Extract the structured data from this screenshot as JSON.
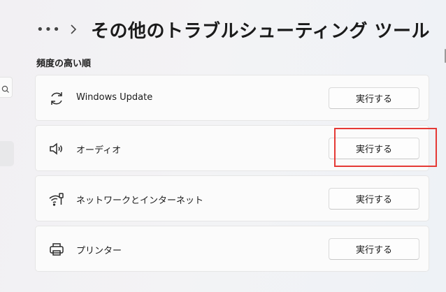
{
  "header": {
    "more_label": "•••",
    "title": "その他のトラブルシューティング ツール"
  },
  "section": {
    "title": "頻度の高い順"
  },
  "troubleshooters": [
    {
      "label": "Windows Update",
      "button": "実行する",
      "icon": "refresh-icon"
    },
    {
      "label": "オーディオ",
      "button": "実行する",
      "icon": "speaker-icon"
    },
    {
      "label": "ネットワークとインターネット",
      "button": "実行する",
      "icon": "wifi-ethernet-icon"
    },
    {
      "label": "プリンター",
      "button": "実行する",
      "icon": "printer-icon"
    }
  ],
  "colors": {
    "highlight": "#e53935",
    "card_bg": "#fbfbfb"
  }
}
